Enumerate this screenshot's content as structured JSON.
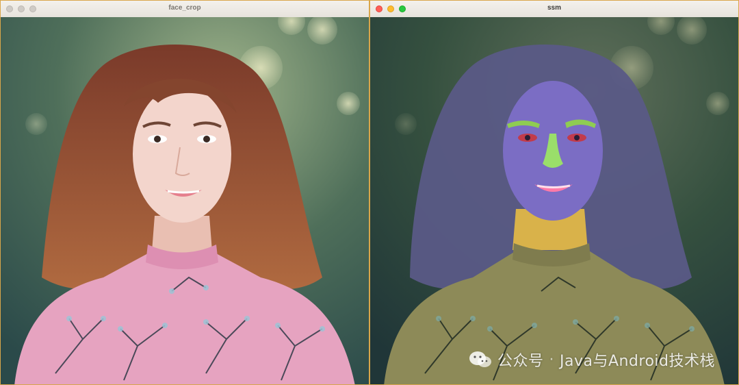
{
  "windows": {
    "left": {
      "title": "face_crop"
    },
    "right": {
      "title": "ssm"
    }
  },
  "images": {
    "left": {
      "subject": "woman-portrait-pink-floral-dress"
    },
    "right": {
      "subject": "face-parsing-segmentation-overlay"
    }
  },
  "colors": {
    "window_border": "#d9a64a",
    "hair_left": "#8a4a32",
    "dress_left": "#e6a3c0",
    "skin_left": "#f1d0c6",
    "face_mask": "#7b6dc4",
    "eyebrow_mask": "#8fcc52",
    "nose_mask": "#9ade6a",
    "neck_mask": "#d9b24a",
    "lip_mask": "#ff7aa8",
    "hair_mask": "#5a5a86",
    "cloth_mask": "#8d8a58"
  },
  "watermark": {
    "icon": "wechat-icon",
    "brand": "公众号",
    "separator": "·",
    "text": "Java与Android技术栈"
  }
}
